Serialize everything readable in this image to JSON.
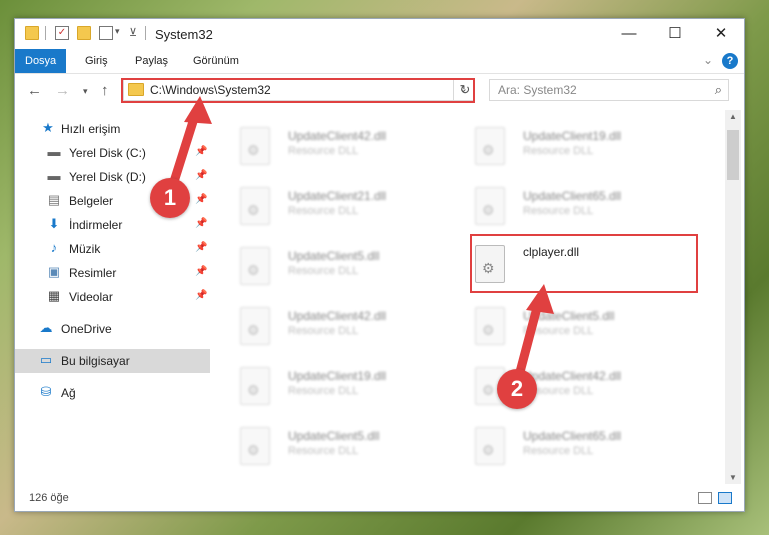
{
  "window": {
    "title": "System32"
  },
  "titlebar": {
    "minimize": "—",
    "maximize": "☐",
    "close": "✕"
  },
  "ribbon": {
    "tabs": [
      "Dosya",
      "Giriş",
      "Paylaş",
      "Görünüm"
    ],
    "help": "?"
  },
  "nav": {
    "address": "C:\\Windows\\System32",
    "search_placeholder": "Ara: System32"
  },
  "sidebar": {
    "items": [
      {
        "label": "Hızlı erişim",
        "icon": "star-icon"
      },
      {
        "label": "Yerel Disk (C:)",
        "icon": "drive-icon"
      },
      {
        "label": "Yerel Disk (D:)",
        "icon": "drive-icon"
      },
      {
        "label": "Belgeler",
        "icon": "documents-icon"
      },
      {
        "label": "İndirmeler",
        "icon": "download-icon"
      },
      {
        "label": "Müzik",
        "icon": "music-icon"
      },
      {
        "label": "Resimler",
        "icon": "pictures-icon"
      },
      {
        "label": "Videolar",
        "icon": "video-icon"
      },
      {
        "label": "OneDrive",
        "icon": "cloud-icon"
      },
      {
        "label": "Bu bilgisayar",
        "icon": "computer-icon"
      },
      {
        "label": "Ağ",
        "icon": "network-icon"
      }
    ]
  },
  "files": [
    {
      "name": "UpdateClient42.dll",
      "desc": "Resource DLL"
    },
    {
      "name": "UpdateClient19.dll",
      "desc": "Resource DLL"
    },
    {
      "name": "UpdateClient21.dll",
      "desc": "Resource DLL"
    },
    {
      "name": "UpdateClient65.dll",
      "desc": "Resource DLL"
    },
    {
      "name": "UpdateClient5.dll",
      "desc": "Resource DLL"
    },
    {
      "name": "clplayer.dll",
      "desc": ""
    },
    {
      "name": "UpdateClient42.dll",
      "desc": "Resource DLL"
    },
    {
      "name": "UpdateClient5.dll",
      "desc": "Resource DLL"
    },
    {
      "name": "UpdateClient19.dll",
      "desc": "Resource DLL"
    },
    {
      "name": "UpdateClient42.dll",
      "desc": "Resource DLL"
    },
    {
      "name": "UpdateClient5.dll",
      "desc": "Resource DLL"
    },
    {
      "name": "UpdateClient65.dll",
      "desc": "Resource DLL"
    }
  ],
  "status": {
    "count": "126 öğe"
  },
  "annotations": {
    "step1": "1",
    "step2": "2",
    "color": "#e04040"
  }
}
